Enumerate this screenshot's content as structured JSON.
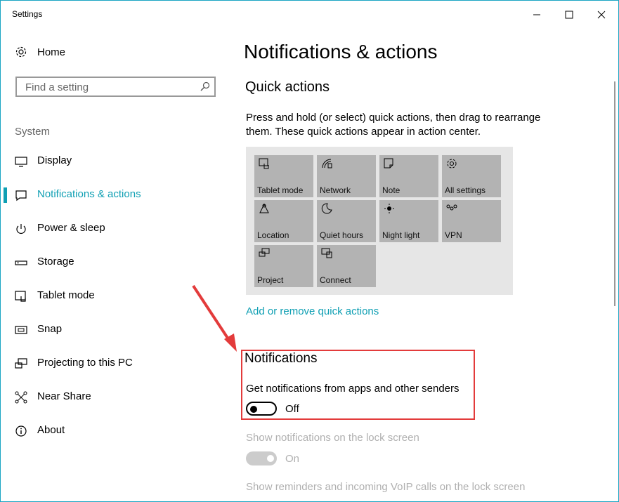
{
  "window": {
    "title": "Settings"
  },
  "sidebar": {
    "home_label": "Home",
    "search_placeholder": "Find a setting",
    "section_label": "System",
    "items": [
      {
        "label": "Display",
        "icon": "display-icon"
      },
      {
        "label": "Notifications & actions",
        "icon": "notifications-icon",
        "active": true
      },
      {
        "label": "Power & sleep",
        "icon": "power-icon"
      },
      {
        "label": "Storage",
        "icon": "storage-icon"
      },
      {
        "label": "Tablet mode",
        "icon": "tablet-mode-icon"
      },
      {
        "label": "Snap",
        "icon": "snap-icon"
      },
      {
        "label": "Projecting to this PC",
        "icon": "projecting-icon"
      },
      {
        "label": "Near Share",
        "icon": "near-share-icon"
      },
      {
        "label": "About",
        "icon": "about-icon"
      }
    ]
  },
  "main": {
    "title": "Notifications & actions",
    "quick_actions": {
      "heading": "Quick actions",
      "description": "Press and hold (or select) quick actions, then drag to rearrange them. These quick actions appear in action center.",
      "tiles": [
        {
          "label": "Tablet mode",
          "icon": "tablet-mode-icon"
        },
        {
          "label": "Network",
          "icon": "network-icon"
        },
        {
          "label": "Note",
          "icon": "note-icon"
        },
        {
          "label": "All settings",
          "icon": "gear-icon"
        },
        {
          "label": "Location",
          "icon": "location-icon"
        },
        {
          "label": "Quiet hours",
          "icon": "moon-icon"
        },
        {
          "label": "Night light",
          "icon": "night-light-icon"
        },
        {
          "label": "VPN",
          "icon": "vpn-icon"
        },
        {
          "label": "Project",
          "icon": "project-icon"
        },
        {
          "label": "Connect",
          "icon": "connect-icon"
        }
      ],
      "link": "Add or remove quick actions"
    },
    "notifications": {
      "heading": "Notifications",
      "get_notifications_label": "Get notifications from apps and other senders",
      "get_notifications_state": "Off",
      "lock_screen_label": "Show notifications on the lock screen",
      "lock_screen_state": "On",
      "reminders_label": "Show reminders and incoming VoIP calls on the lock screen"
    }
  },
  "colors": {
    "accent": "#0f9fb3",
    "highlight_box": "#e33b3b",
    "arrow": "#e33b3b",
    "tile": "#b3b3b3"
  }
}
